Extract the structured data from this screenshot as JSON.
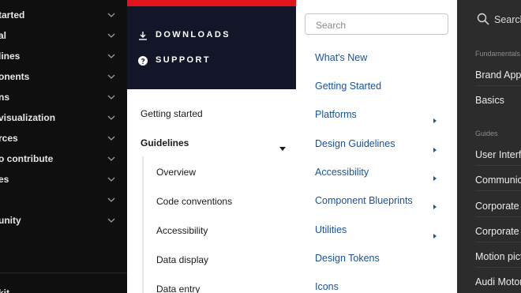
{
  "left_nav": {
    "items": [
      {
        "label": "tarted"
      },
      {
        "label": "al"
      },
      {
        "label": "lines"
      },
      {
        "label": "onents"
      },
      {
        "label": "ns"
      },
      {
        "label": "visualization"
      },
      {
        "label": "rces"
      },
      {
        "label": "o contribute"
      },
      {
        "label": "es"
      },
      {
        "label": ""
      },
      {
        "label": "unity"
      }
    ],
    "bottom_label": "kit"
  },
  "navy_nav": {
    "accent_color": "#e1141d",
    "links": [
      {
        "label": "DOWNLOADS",
        "icon": "download-icon"
      },
      {
        "label": "SUPPORT",
        "icon": "help-icon"
      }
    ],
    "items": [
      {
        "label": "Getting started"
      },
      {
        "label": "Guidelines"
      }
    ],
    "sub_items": [
      {
        "label": "Overview"
      },
      {
        "label": "Code conventions"
      },
      {
        "label": "Accessibility"
      },
      {
        "label": "Data display"
      },
      {
        "label": "Data entry"
      }
    ]
  },
  "design_system_nav": {
    "search_placeholder": "Search",
    "link_color": "#1b5297",
    "items": [
      {
        "label": "What's New",
        "has_arrow": false
      },
      {
        "label": "Getting Started",
        "has_arrow": false
      },
      {
        "label": "Platforms",
        "has_arrow": true
      },
      {
        "label": "Design Guidelines",
        "has_arrow": true
      },
      {
        "label": "Accessibility",
        "has_arrow": true
      },
      {
        "label": "Component Blueprints",
        "has_arrow": true
      },
      {
        "label": "Utilities",
        "has_arrow": true
      },
      {
        "label": "Design Tokens",
        "has_arrow": false
      },
      {
        "label": "Icons",
        "has_arrow": false
      }
    ]
  },
  "brand_nav": {
    "search_label": "Search",
    "section_fundamentals": "Fundamentals",
    "fundamentals": [
      {
        "label": "Brand Appearance"
      },
      {
        "label": "Basics"
      }
    ],
    "section_guides": "Guides",
    "guides": [
      {
        "label": "User Interface"
      },
      {
        "label": "Communication"
      },
      {
        "label": "Corporate"
      },
      {
        "label": "Corporate"
      },
      {
        "label": "Motion picture"
      },
      {
        "label": "Audi Motorsport"
      }
    ]
  }
}
